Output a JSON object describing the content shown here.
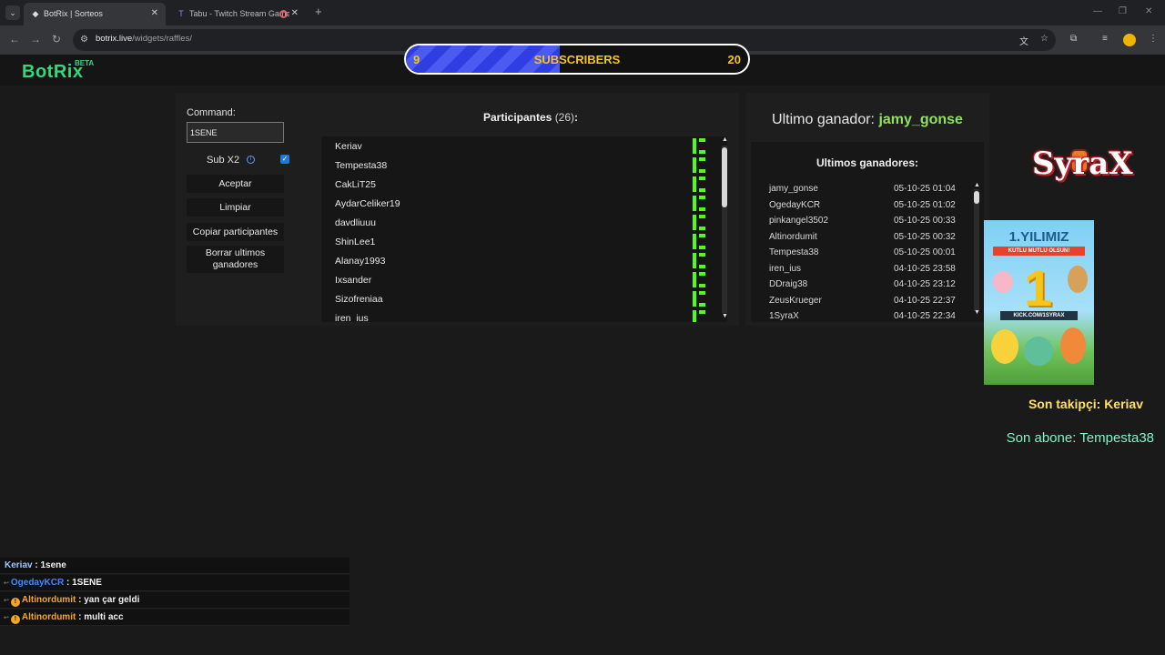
{
  "browser": {
    "tabs": [
      {
        "title": "BotRix | Sorteos",
        "active": true
      },
      {
        "title": "Tabu - Twitch Stream Game",
        "active": false
      }
    ],
    "url_host": "botrix.live",
    "url_path": "/widgets/raffles/"
  },
  "logo": {
    "text": "BotRix",
    "badge": "BETA"
  },
  "subscribers_bar": {
    "current": "9",
    "label": "SUBSCRIBERS",
    "goal": "20",
    "progress_fraction": 0.45
  },
  "raffle": {
    "command_label": "Command:",
    "command_value": "1SENE",
    "sub_x2_label": "Sub X2",
    "sub_x2_checked": true,
    "buttons": {
      "accept": "Aceptar",
      "clear": "Limpiar",
      "copy": "Copiar participantes",
      "clear_winners": "Borrar ultimos ganadores"
    },
    "participants_title": "Participantes",
    "participants_count": "(26)",
    "participants_colon": ":",
    "participants": [
      "Keriav",
      "Tempesta38",
      "CakLiT25",
      "AydarCeliker19",
      "davdliuuu",
      "ShinLee1",
      "Alanay1993",
      "Ixsander",
      "Sizofreniaa",
      "iren_ius"
    ]
  },
  "winners": {
    "last_winner_label": "Ultimo ganador:",
    "last_winner_name": "jamy_gonse",
    "list_title": "Ultimos ganadores:",
    "list": [
      {
        "name": "jamy_gonse",
        "date": "05-10-25 01:04"
      },
      {
        "name": "OgedayKCR",
        "date": "05-10-25 01:02"
      },
      {
        "name": "pinkangel3502",
        "date": "05-10-25 00:33"
      },
      {
        "name": "Altinordumit",
        "date": "05-10-25 00:32"
      },
      {
        "name": "Tempesta38",
        "date": "05-10-25 00:01"
      },
      {
        "name": "iren_ius",
        "date": "04-10-25 23:58"
      },
      {
        "name": "DDraig38",
        "date": "04-10-25 23:12"
      },
      {
        "name": "ZeusKrueger",
        "date": "04-10-25 22:37"
      },
      {
        "name": "1SyraX",
        "date": "04-10-25 22:34"
      }
    ]
  },
  "overlay": {
    "brand": "SyraX",
    "poster_headline": "1.YILIMIZ",
    "poster_sub": "KUTLU MUTLU OLSUN!",
    "poster_number": "1",
    "poster_url": "KICK.COM/1SYRAX",
    "last_follower_label": "Son takipçi:",
    "last_follower_name": "Keriav",
    "last_sub_label": "Son abone:",
    "last_sub_name": "Tempesta38"
  },
  "chat": [
    {
      "user": "Keriav",
      "message": "1sene",
      "color": "#9ec8ff",
      "badge": false
    },
    {
      "user": "OgedayKCR",
      "message": "1SENE",
      "color": "#3d8bff",
      "badge": false
    },
    {
      "user": "Altinordumit",
      "message": "yan çar geldi",
      "color": "#f5a623",
      "badge": true
    },
    {
      "user": "Altinordumit",
      "message": "multi acc",
      "color": "#f5a623",
      "badge": true
    }
  ],
  "colors": {
    "brand_green": "#37d67a",
    "kick_green": "#53fc18",
    "sub_bar_blue": "#2e3ee0",
    "label_yellow": "#f5c518"
  }
}
